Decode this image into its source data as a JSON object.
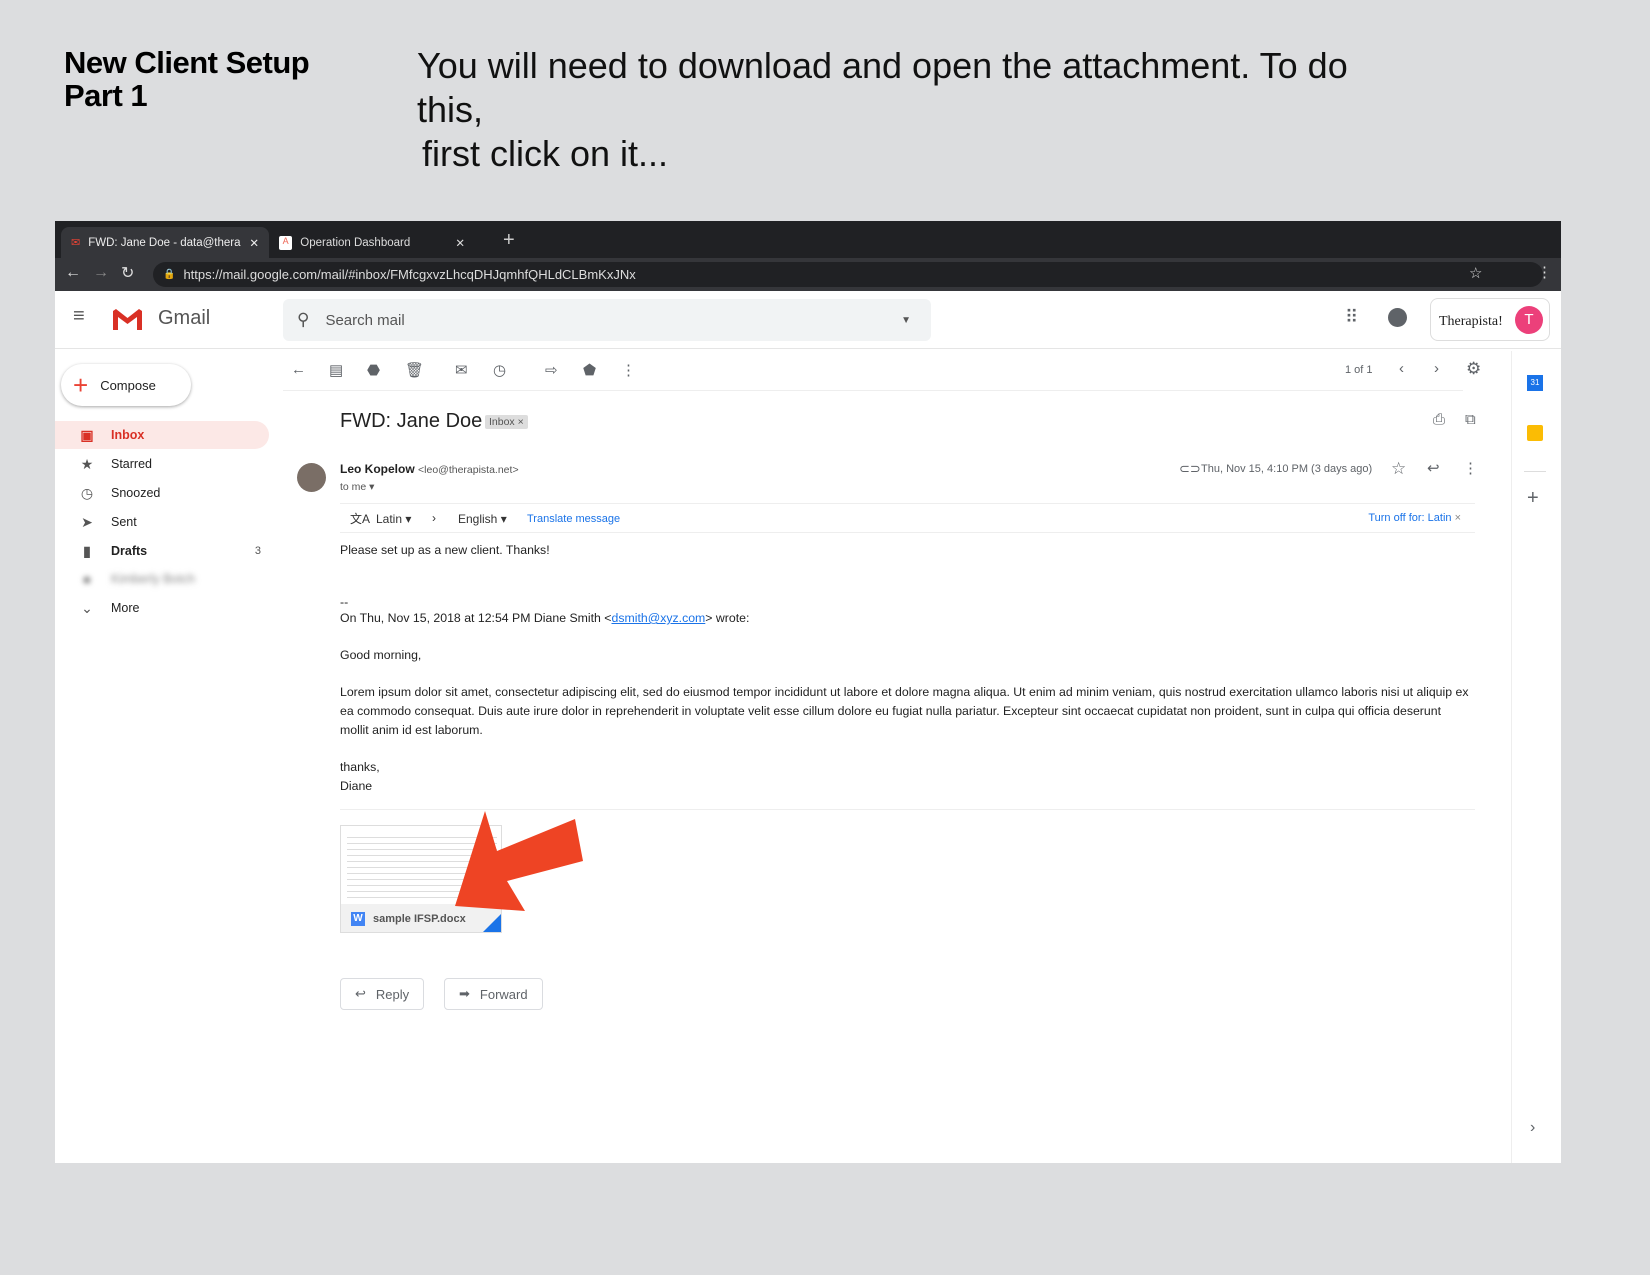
{
  "page": {
    "title_line1": "New Client Setup",
    "title_line2": "Part 1",
    "instruction_line1": "You will need to download and open the attachment. To do this,",
    "instruction_line2": "first click on it..."
  },
  "browser": {
    "tabs": [
      {
        "label": "FWD: Jane Doe - data@therapi",
        "icon": "gmail-icon"
      },
      {
        "label": "Operation Dashboard",
        "icon": "app-icon"
      }
    ],
    "url": "https://mail.google.com/mail/#inbox/FMfcgxvzLhcqDHJqmhfQHLdCLBmKxJNx"
  },
  "gmail": {
    "app_name": "Gmail",
    "search_placeholder": "Search mail",
    "account_logo": "Therapista!",
    "avatar_letter": "T",
    "avatar_color": "#ec407a",
    "compose": "Compose",
    "sidebar": [
      {
        "label": "Inbox",
        "icon": "inbox-icon"
      },
      {
        "label": "Starred",
        "icon": "star-icon"
      },
      {
        "label": "Snoozed",
        "icon": "clock-icon"
      },
      {
        "label": "Sent",
        "icon": "send-icon"
      },
      {
        "label": "Drafts",
        "icon": "draft-icon",
        "count": "3"
      },
      {
        "label": "Kimberly Botch",
        "icon": "label-icon"
      },
      {
        "label": "More",
        "icon": "chevron-down-icon"
      }
    ],
    "pager": "1 of 1",
    "email": {
      "subject": "FWD: Jane Doe",
      "label": "Inbox",
      "sender_name": "Leo Kopelow",
      "sender_email": "<leo@therapista.net>",
      "to": "to me",
      "date": "Thu, Nov 15, 4:10 PM (3 days ago)",
      "translate": {
        "from": "Latin",
        "to": "English",
        "action": "Translate message",
        "turn_off": "Turn off for: Latin"
      },
      "body": [
        "Please set up as a new client. Thanks!",
        "--",
        "On Thu, Nov 15, 2018 at 12:54 PM Diane Smith <",
        "dsmith@xyz.com",
        "> wrote:",
        "Good morning,",
        "Lorem ipsum dolor sit amet, consectetur adipiscing elit, sed do eiusmod tempor incididunt ut labore et dolore magna aliqua. Ut enim ad minim veniam, quis nostrud exercitation ullamco laboris nisi ut aliquip ex ea commodo consequat. Duis aute irure dolor in reprehenderit in voluptate velit esse cillum dolore eu fugiat nulla pariatur. Excepteur sint occaecat cupidatat non proident, sunt in culpa qui officia deserunt mollit anim id est laborum.",
        "thanks,",
        "Diane"
      ],
      "attachment": "sample IFSP.docx",
      "reply": "Reply",
      "forward": "Forward"
    }
  },
  "colors": {
    "arrow": "#ee4424",
    "link": "#1a73e8"
  }
}
